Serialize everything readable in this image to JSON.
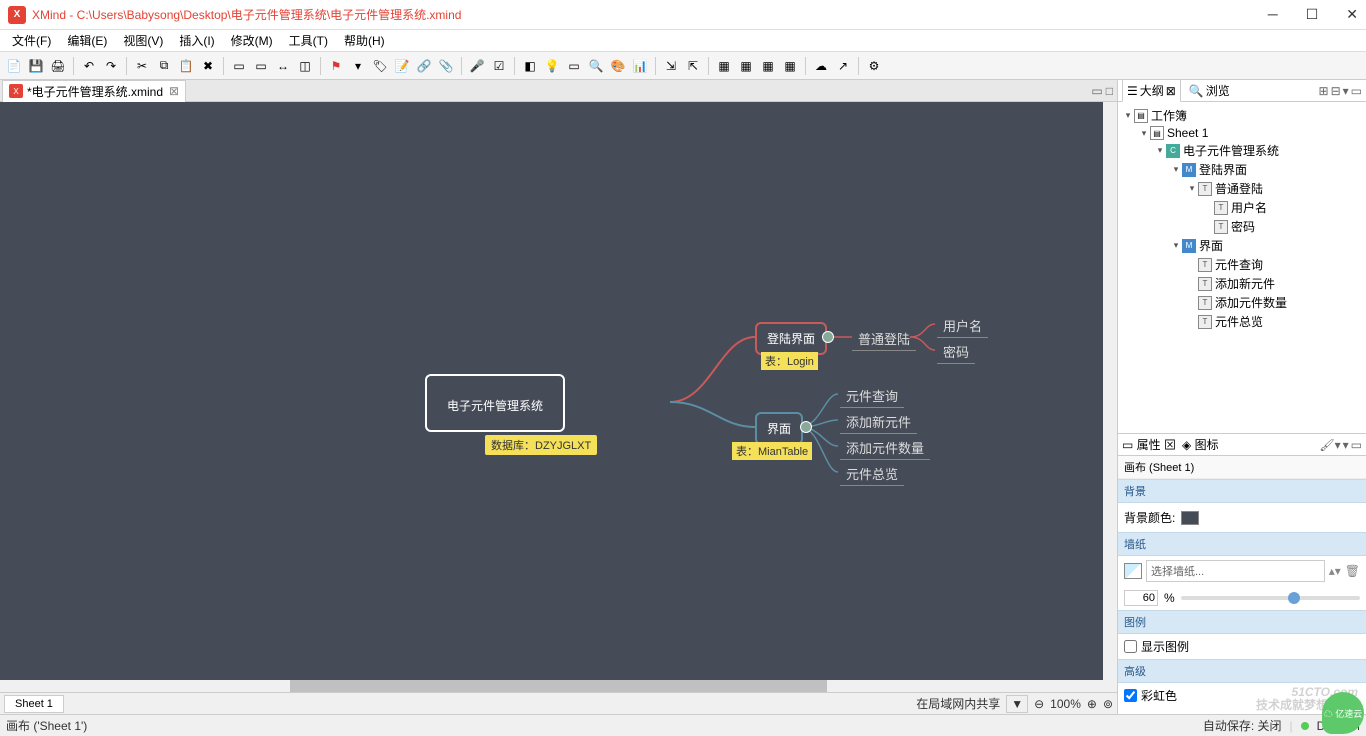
{
  "title": "XMind - C:\\Users\\Babysong\\Desktop\\电子元件管理系统\\电子元件管理系统.xmind",
  "menu": [
    "文件(F)",
    "编辑(E)",
    "视图(V)",
    "插入(I)",
    "修改(M)",
    "工具(T)",
    "帮助(H)"
  ],
  "tab": {
    "label": "*电子元件管理系统.xmind"
  },
  "mindmap": {
    "root": "电子元件管理系统",
    "root_note": "数据库：DZYJGLXT",
    "b1": {
      "label": "登陆界面",
      "note": "表：Login",
      "sub": "普通登陆",
      "leaves": [
        "用户名",
        "密码"
      ]
    },
    "b2": {
      "label": "界面",
      "note": "表：MianTable",
      "leaves": [
        "元件查询",
        "添加新元件",
        "添加元件数量",
        "元件总览"
      ]
    }
  },
  "sheet": "Sheet 1",
  "bottom": {
    "share": "在局域网内共享",
    "zoom": "100%"
  },
  "side": {
    "outline_tab": "大纲",
    "browse_tab": "浏览",
    "nodes": {
      "workbook": "工作簿",
      "sheet": "Sheet 1",
      "root": "电子元件管理系统",
      "login_ui": "登陆界面",
      "normal_login": "普通登陆",
      "username": "用户名",
      "password": "密码",
      "ui": "界面",
      "q": "元件查询",
      "add": "添加新元件",
      "addqty": "添加元件数量",
      "overview": "元件总览"
    },
    "props_tab": "属性",
    "icon_tab": "图标",
    "props_title": "画布 (Sheet 1)",
    "bg_section": "背景",
    "bg_color_label": "背景颜色:",
    "wp_section": "墙纸",
    "wp_placeholder": "选择墙纸...",
    "opacity": "60",
    "pct": "%",
    "legend_section": "图例",
    "show_legend": "显示图例",
    "adv_section": "高级",
    "rainbow": "彩虹色"
  },
  "status": {
    "left": "画布 ('Sheet 1')",
    "autosave": "自动保存: 关闭",
    "theme": "DREAM"
  },
  "watermark": {
    "main": "51CTO.com",
    "sub": "技术成就梦想    Blog"
  }
}
